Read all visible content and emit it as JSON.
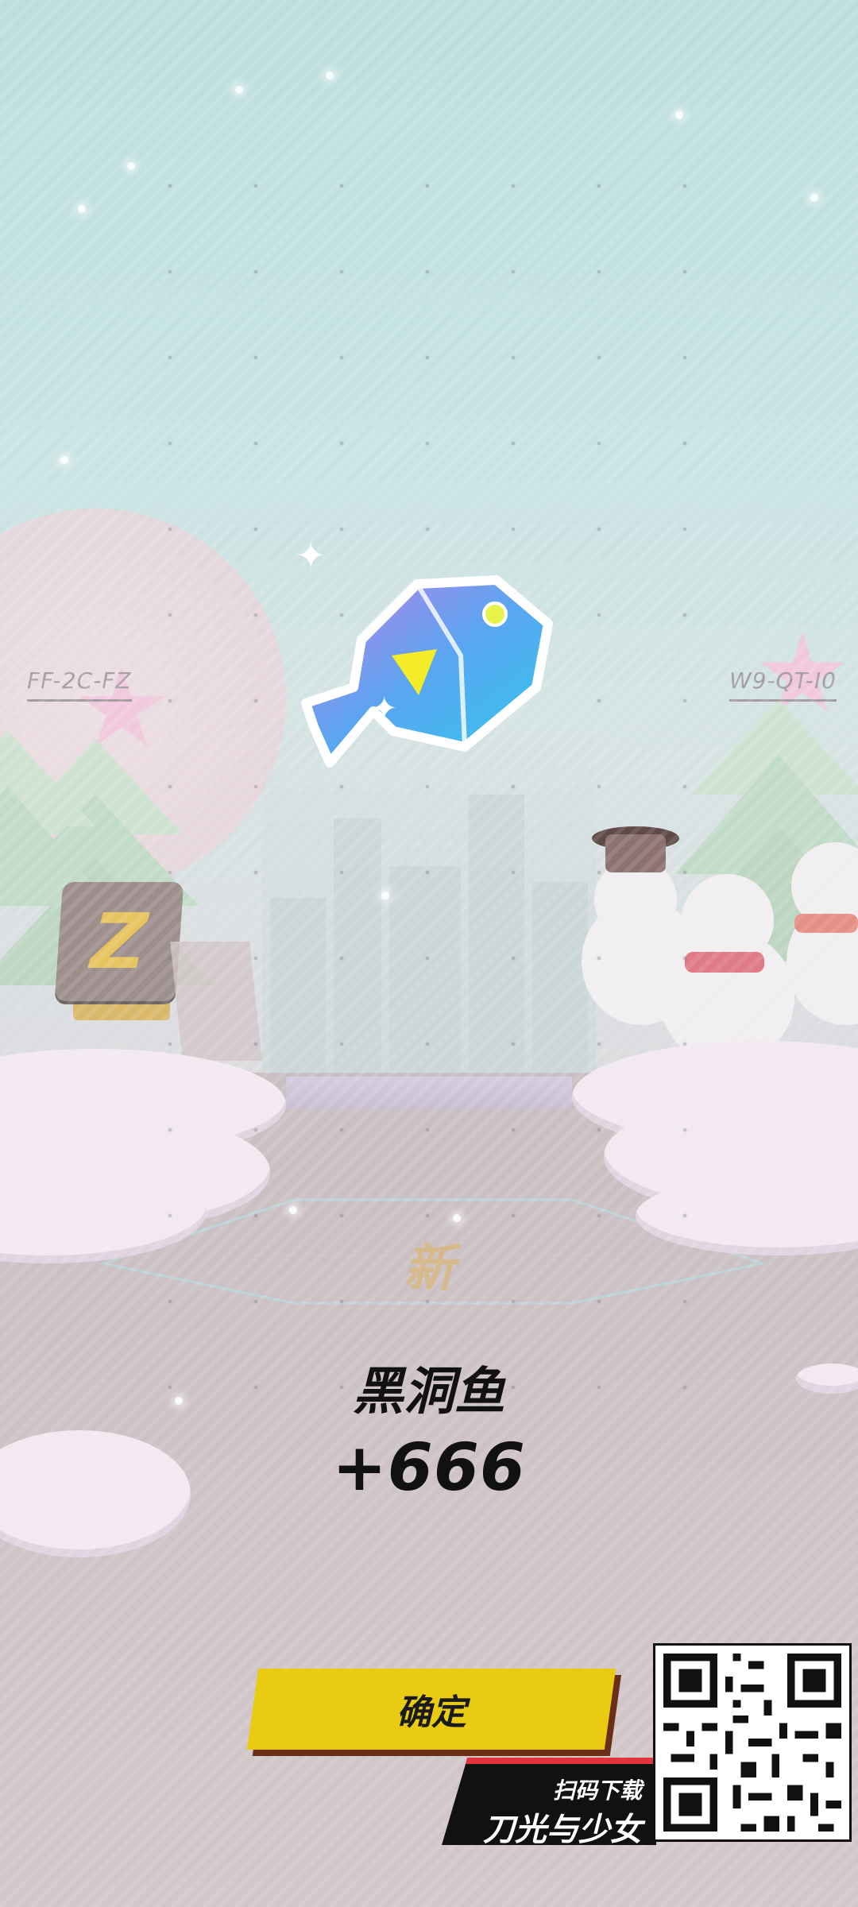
{
  "scene": {
    "left_code": "FF-2C-FZ",
    "right_code": "W9-QT-I0",
    "z_block_letter": "Z"
  },
  "reward": {
    "new_tag": "新",
    "item_name": "黑洞鱼",
    "item_count": "+666",
    "item_icon": "fish-icon"
  },
  "actions": {
    "confirm_label": "确定"
  },
  "promo": {
    "scan_text": "扫码下载",
    "game_title": "刀光与少女",
    "qr_icon": "qr-code-icon"
  },
  "colors": {
    "confirm_button": "#e9cc12",
    "confirm_shadow": "#6b2f17",
    "promo_bg": "#111111",
    "promo_accent": "#e0333d",
    "fish_primary": "#35c2ef",
    "fish_secondary": "#b07be8"
  }
}
